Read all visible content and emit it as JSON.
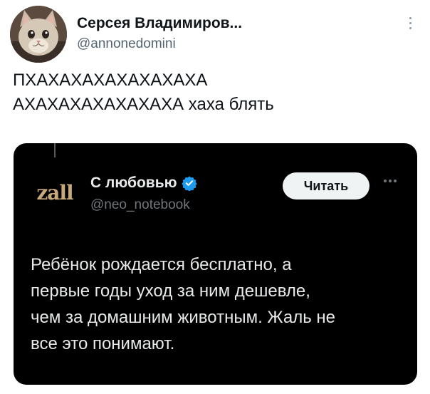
{
  "author": {
    "name": "Серсея Владимиров...",
    "handle": "@annonedomini",
    "avatar_icon": "cat-avatar-icon"
  },
  "tweet": {
    "lines": [
      "ПХАХАХАХАХАХАХАХА",
      "АХАХАХАХАХАХАХА хаха блять"
    ]
  },
  "quoted": {
    "avatar_text": "zall",
    "name": "С любовью",
    "verified_icon": "verified-badge-icon",
    "handle": "@neo_notebook",
    "follow_label": "Читать",
    "lines": [
      "Ребёнок рождается бесплатно, а",
      "первые годы уход за ним дешевле,",
      "чем за домашним животным. Жаль не",
      "все это понимают."
    ]
  },
  "colors": {
    "verified": "#1d9bf0",
    "quote_bg": "#000000",
    "avatar_brand": "#c8aa7a"
  }
}
